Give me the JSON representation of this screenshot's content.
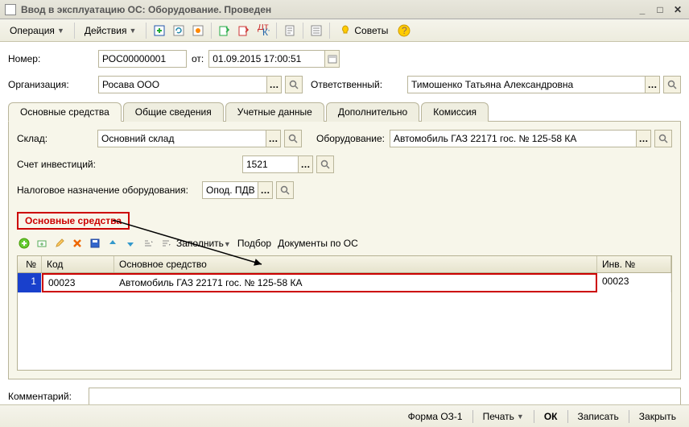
{
  "window": {
    "title": "Ввод в эксплуатацию ОС: Оборудование. Проведен"
  },
  "menu": {
    "operation": "Операция",
    "actions": "Действия",
    "tips": "Советы"
  },
  "form": {
    "number_label": "Номер:",
    "number_value": "РОС00000001",
    "from_label": "от:",
    "date_value": "01.09.2015 17:00:51",
    "org_label": "Организация:",
    "org_value": "Росава ООО",
    "resp_label": "Ответственный:",
    "resp_value": "Тимошенко Татьяна Александровна"
  },
  "tabs": {
    "t1": "Основные средства",
    "t2": "Общие сведения",
    "t3": "Учетные данные",
    "t4": "Дополнительно",
    "t5": "Комиссия"
  },
  "panel": {
    "sklad_label": "Склад:",
    "sklad_value": "Основний склад",
    "equip_label": "Оборудование:",
    "equip_value": "Автомобиль ГАЗ 22171 гос. № 125-58 КА",
    "invacc_label": "Счет инвестиций:",
    "invacc_value": "1521",
    "tax_label": "Налоговое назначение оборудования:",
    "tax_value": "Опод. ПДВ"
  },
  "section": {
    "title": "Основные средства"
  },
  "gridbar": {
    "fill": "Заполнить",
    "pick": "Подбор",
    "docs": "Документы по ОС"
  },
  "grid": {
    "h_n": "№",
    "h_code": "Код",
    "h_main": "Основное средство",
    "h_inv": "Инв. №",
    "rows": [
      {
        "n": "1",
        "code": "00023",
        "main": "Автомобиль ГАЗ 22171 гос. № 125-58 КА",
        "inv": "00023"
      }
    ]
  },
  "comment": {
    "label": "Комментарий:"
  },
  "footer": {
    "form": "Форма ОЗ-1",
    "print": "Печать",
    "ok": "ОК",
    "save": "Записать",
    "close": "Закрыть"
  }
}
